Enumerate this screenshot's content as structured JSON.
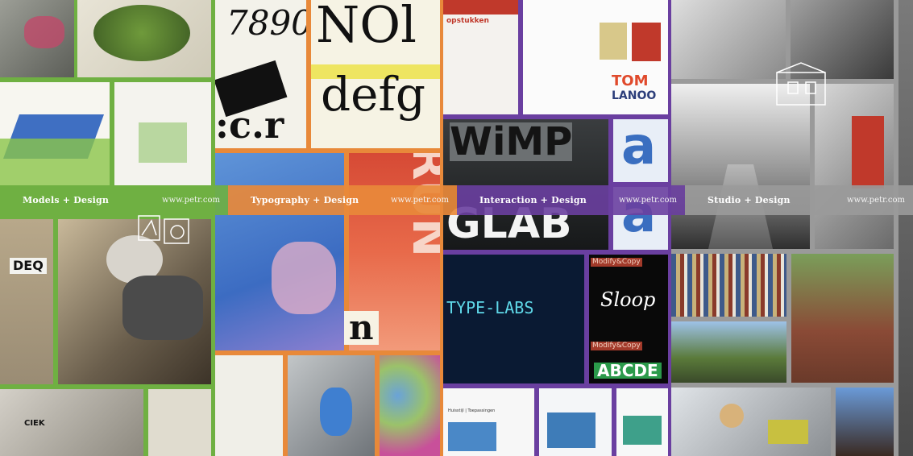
{
  "panels": [
    {
      "label": "Models + Design",
      "url": "www.petr.com",
      "color": "#6fb042"
    },
    {
      "label": "Typography + Design",
      "url": "www.petr.com",
      "color": "#e8893a"
    },
    {
      "label": "Interaction + Design",
      "url": "www.petr.com",
      "color": "#6a3fa0"
    },
    {
      "label": "Studio + Design",
      "url": "www.petr.com",
      "color": "#9a9a9a"
    }
  ],
  "photo_text": {
    "deq": "DEQ",
    "nol": "NOl",
    "defg": "defg",
    "digits": "7890",
    "wimp": "WiMP",
    "glab": "GLAB",
    "typelabs": "TYPE-LABS",
    "modify1": "Modify&Copy",
    "modify2": "Modify&Copy",
    "sloop": "Sloop",
    "abcde": "ABCDE",
    "opstukken": "opstukken",
    "tom": "TOM",
    "lanoo": "LANOO",
    "huisstijl": "Huisstijl | Toepassingen",
    "sign_n": "n",
    "ciek": "CIEK"
  }
}
